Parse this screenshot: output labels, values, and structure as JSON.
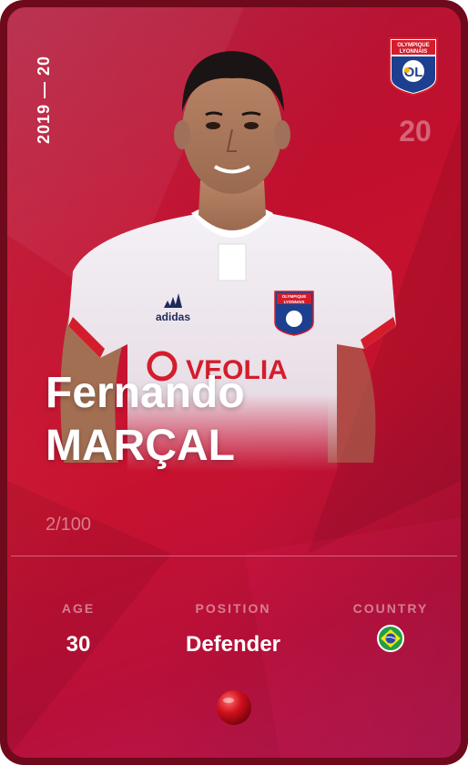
{
  "card": {
    "season": "2019 — 20",
    "shirt_number": "20",
    "first_name": "Fernando",
    "last_name": "MARÇAL",
    "serial": "2/100",
    "club": {
      "crest_line1": "OLYMPIQUE",
      "crest_line2": "LYONNAIS",
      "crest_mark": "OL",
      "colors": {
        "blue": "#1d3f8f",
        "red": "#d41d2c",
        "gold": "#f2b705"
      }
    },
    "jersey": {
      "sponsor": "VEOLIA",
      "brand": "adidas",
      "crest_line1": "OLYMPIQUE",
      "crest_line2": "LYONNAIS"
    },
    "stats": {
      "age_label": "AGE",
      "age_value": "30",
      "position_label": "POSITION",
      "position_value": "Defender",
      "country_label": "COUNTRY",
      "country_icon": "brazil-flag-icon"
    },
    "rarity_icon": "red-gem-icon",
    "colors": {
      "card_base": "#c0102e",
      "card_border": "#6e0a1c",
      "gem": "#d0101c"
    }
  }
}
